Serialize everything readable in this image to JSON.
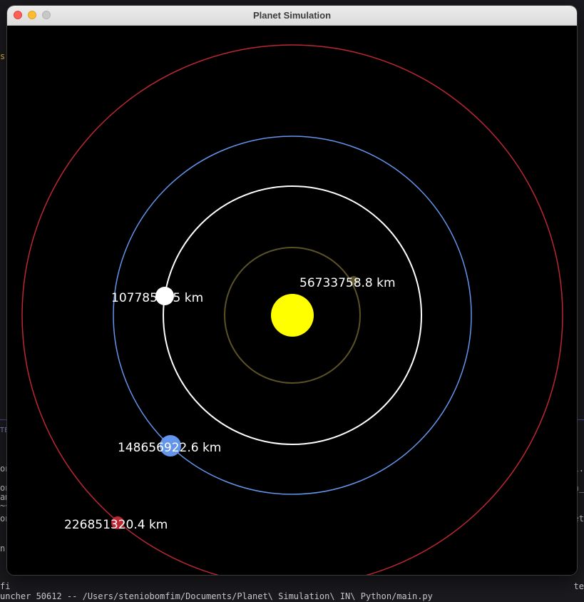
{
  "window": {
    "title": "Planet Simulation"
  },
  "background_terminal": {
    "bottom_line": "uncher 50612 -- /Users/steniobomfim/Documents/Planet\\ Simulation\\ IN\\ Python/main.py",
    "fragments_left": [
      "s]",
      "TE",
      "on",
      "on",
      "am",
      "~~",
      "on",
      "n",
      "fi"
    ],
    "fragments_right": [
      "i.",
      "n_",
      "et",
      "te"
    ]
  },
  "colors": {
    "sun": "#ffff00",
    "mercury_orbit": "#5a5228",
    "mercury": "#5a5228",
    "venus": "#ffffff",
    "earth": "#6495ed",
    "mars": "#bc2732",
    "background": "#000000"
  },
  "bodies": {
    "sun": {
      "name": "sun",
      "icon": "sun-circle"
    },
    "mercury": {
      "distance_label": "56733758.8 km"
    },
    "venus": {
      "distance_label": "107785 9.5 km"
    },
    "earth": {
      "distance_label": "148656922.6 km"
    },
    "mars": {
      "distance_label": "226851320.4 km"
    }
  }
}
